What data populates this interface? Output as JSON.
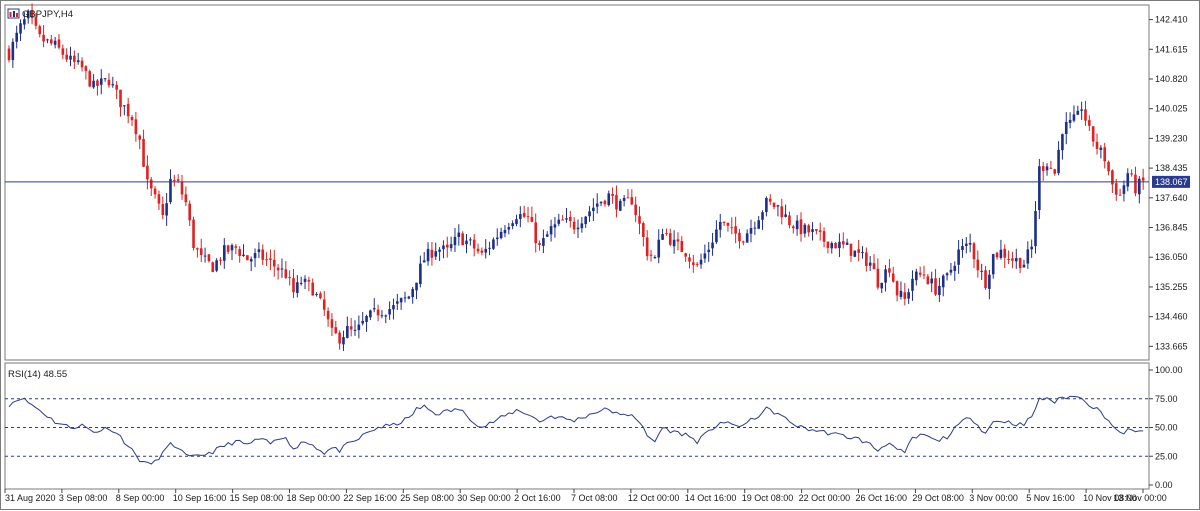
{
  "window": {
    "symbol_title": "GBPJPY,H4",
    "rsi_title": "RSI(14) 48.55",
    "current_price_label": "138.067"
  },
  "colors": {
    "bull": "#1c2f8a",
    "bear": "#e22020",
    "rsi_line": "#2a3a8c",
    "price_line": "#2a3a8c",
    "level_line": "#2a3a8c",
    "text": "#1a1a1a"
  },
  "chart_data": [
    {
      "type": "candlestick",
      "title": "GBPJPY,H4",
      "y_ticks": [
        "142.410",
        "141.615",
        "140.820",
        "140.025",
        "139.230",
        "138.435",
        "137.640",
        "136.845",
        "136.050",
        "135.255",
        "134.460",
        "133.665"
      ],
      "ylim": [
        133.3,
        142.8
      ],
      "current_price": 138.067,
      "x_ticks": [
        "31 Aug 2020",
        "3 Sep 08:00",
        "8 Sep 00:00",
        "10 Sep 16:00",
        "15 Sep 08:00",
        "18 Sep 00:00",
        "22 Sep 16:00",
        "25 Sep 08:00",
        "30 Sep 00:00",
        "2 Oct 16:00",
        "7 Oct 08:00",
        "12 Oct 00:00",
        "14 Oct 16:00",
        "19 Oct 08:00",
        "22 Oct 00:00",
        "26 Oct 16:00",
        "29 Oct 08:00",
        "3 Nov 00:00",
        "5 Nov 16:00",
        "10 Nov 08:00",
        "13 Nov 00:00"
      ],
      "close_path": [
        [
          0,
          141.5
        ],
        [
          3,
          142.2
        ],
        [
          5,
          142.5
        ],
        [
          8,
          141.9
        ],
        [
          12,
          141.7
        ],
        [
          16,
          141.3
        ],
        [
          19,
          141.1
        ],
        [
          22,
          140.6
        ],
        [
          26,
          140.8
        ],
        [
          29,
          140.2
        ],
        [
          32,
          139.8
        ],
        [
          34,
          139.2
        ],
        [
          36,
          138.0
        ],
        [
          38,
          137.6
        ],
        [
          40,
          137.1
        ],
        [
          42,
          138.1
        ],
        [
          44,
          138.0
        ],
        [
          46,
          137.5
        ],
        [
          48,
          136.4
        ],
        [
          50,
          136.0
        ],
        [
          53,
          135.8
        ],
        [
          56,
          136.2
        ],
        [
          59,
          136.3
        ],
        [
          62,
          136.0
        ],
        [
          65,
          136.1
        ],
        [
          68,
          135.9
        ],
        [
          72,
          135.6
        ],
        [
          74,
          135.1
        ],
        [
          76,
          135.4
        ],
        [
          79,
          135.2
        ],
        [
          82,
          134.6
        ],
        [
          84,
          134.0
        ],
        [
          86,
          133.9
        ],
        [
          88,
          134.1
        ],
        [
          90,
          134.0
        ],
        [
          93,
          134.4
        ],
        [
          96,
          134.6
        ],
        [
          100,
          134.7
        ],
        [
          104,
          135.0
        ],
        [
          106,
          135.5
        ],
        [
          108,
          136.0
        ],
        [
          111,
          136.3
        ],
        [
          114,
          136.2
        ],
        [
          117,
          136.6
        ],
        [
          120,
          136.4
        ],
        [
          123,
          136.1
        ],
        [
          126,
          136.5
        ],
        [
          129,
          136.9
        ],
        [
          132,
          137.2
        ],
        [
          135,
          137.1
        ],
        [
          138,
          136.3
        ],
        [
          141,
          136.8
        ],
        [
          144,
          137.0
        ],
        [
          147,
          136.9
        ],
        [
          150,
          137.2
        ],
        [
          153,
          137.5
        ],
        [
          156,
          137.7
        ],
        [
          159,
          137.4
        ],
        [
          162,
          137.6
        ],
        [
          164,
          136.9
        ],
        [
          166,
          136.2
        ],
        [
          168,
          136.0
        ],
        [
          170,
          136.8
        ],
        [
          173,
          136.4
        ],
        [
          176,
          136.2
        ],
        [
          179,
          135.8
        ],
        [
          182,
          136.3
        ],
        [
          185,
          137.0
        ],
        [
          188,
          136.7
        ],
        [
          191,
          136.6
        ],
        [
          194,
          137.0
        ],
        [
          197,
          137.5
        ],
        [
          200,
          137.4
        ],
        [
          203,
          137.0
        ],
        [
          206,
          136.8
        ],
        [
          209,
          136.7
        ],
        [
          212,
          136.5
        ],
        [
          215,
          136.4
        ],
        [
          218,
          136.3
        ],
        [
          221,
          136.1
        ],
        [
          224,
          135.9
        ],
        [
          226,
          135.4
        ],
        [
          229,
          135.8
        ],
        [
          231,
          135.1
        ],
        [
          233,
          134.9
        ],
        [
          235,
          135.5
        ],
        [
          238,
          135.6
        ],
        [
          241,
          135.2
        ],
        [
          244,
          135.5
        ],
        [
          247,
          136.2
        ],
        [
          250,
          136.4
        ],
        [
          252,
          135.8
        ],
        [
          254,
          135.4
        ],
        [
          256,
          136.1
        ],
        [
          258,
          136.2
        ],
        [
          261,
          136.0
        ],
        [
          264,
          135.9
        ],
        [
          266,
          136.3
        ],
        [
          268,
          138.4
        ],
        [
          270,
          138.6
        ],
        [
          272,
          138.3
        ],
        [
          274,
          139.5
        ],
        [
          276,
          139.6
        ],
        [
          278,
          139.8
        ],
        [
          279,
          140.1
        ],
        [
          281,
          139.4
        ],
        [
          283,
          139.0
        ],
        [
          285,
          138.7
        ],
        [
          287,
          138.0
        ],
        [
          289,
          137.7
        ],
        [
          291,
          138.3
        ],
        [
          293,
          137.9
        ],
        [
          295,
          138.06
        ]
      ]
    },
    {
      "type": "line",
      "title": "RSI(14) 48.55",
      "value": 48.55,
      "y_ticks": [
        "100.00",
        "75.00",
        "50.00",
        "25.00",
        "0.00"
      ],
      "ylim": [
        0,
        100
      ],
      "levels": [
        75,
        50,
        25
      ],
      "rsi_path": [
        [
          0,
          70
        ],
        [
          3,
          76
        ],
        [
          5,
          72
        ],
        [
          8,
          65
        ],
        [
          12,
          55
        ],
        [
          16,
          50
        ],
        [
          19,
          52
        ],
        [
          22,
          46
        ],
        [
          26,
          50
        ],
        [
          29,
          42
        ],
        [
          32,
          30
        ],
        [
          34,
          22
        ],
        [
          36,
          18
        ],
        [
          38,
          20
        ],
        [
          40,
          28
        ],
        [
          42,
          35
        ],
        [
          44,
          33
        ],
        [
          46,
          25
        ],
        [
          48,
          24
        ],
        [
          50,
          26
        ],
        [
          53,
          29
        ],
        [
          56,
          34
        ],
        [
          59,
          38
        ],
        [
          62,
          35
        ],
        [
          65,
          40
        ],
        [
          68,
          36
        ],
        [
          72,
          43
        ],
        [
          74,
          30
        ],
        [
          76,
          38
        ],
        [
          79,
          35
        ],
        [
          82,
          28
        ],
        [
          84,
          32
        ],
        [
          86,
          30
        ],
        [
          88,
          35
        ],
        [
          90,
          38
        ],
        [
          93,
          45
        ],
        [
          96,
          50
        ],
        [
          100,
          52
        ],
        [
          104,
          58
        ],
        [
          106,
          66
        ],
        [
          108,
          68
        ],
        [
          111,
          62
        ],
        [
          114,
          64
        ],
        [
          117,
          66
        ],
        [
          120,
          58
        ],
        [
          123,
          50
        ],
        [
          126,
          55
        ],
        [
          129,
          60
        ],
        [
          132,
          65
        ],
        [
          135,
          62
        ],
        [
          138,
          55
        ],
        [
          141,
          60
        ],
        [
          144,
          58
        ],
        [
          147,
          56
        ],
        [
          150,
          60
        ],
        [
          153,
          64
        ],
        [
          156,
          66
        ],
        [
          159,
          60
        ],
        [
          162,
          62
        ],
        [
          164,
          55
        ],
        [
          166,
          42
        ],
        [
          168,
          38
        ],
        [
          170,
          50
        ],
        [
          173,
          46
        ],
        [
          176,
          44
        ],
        [
          179,
          38
        ],
        [
          182,
          46
        ],
        [
          185,
          55
        ],
        [
          188,
          52
        ],
        [
          191,
          52
        ],
        [
          194,
          58
        ],
        [
          197,
          66
        ],
        [
          200,
          62
        ],
        [
          203,
          55
        ],
        [
          206,
          50
        ],
        [
          209,
          48
        ],
        [
          212,
          46
        ],
        [
          215,
          44
        ],
        [
          218,
          42
        ],
        [
          221,
          40
        ],
        [
          224,
          35
        ],
        [
          226,
          30
        ],
        [
          229,
          38
        ],
        [
          231,
          30
        ],
        [
          233,
          28
        ],
        [
          235,
          40
        ],
        [
          238,
          44
        ],
        [
          241,
          38
        ],
        [
          244,
          42
        ],
        [
          247,
          52
        ],
        [
          250,
          60
        ],
        [
          252,
          52
        ],
        [
          254,
          45
        ],
        [
          256,
          55
        ],
        [
          258,
          56
        ],
        [
          261,
          54
        ],
        [
          264,
          52
        ],
        [
          266,
          60
        ],
        [
          268,
          74
        ],
        [
          270,
          76
        ],
        [
          272,
          72
        ],
        [
          274,
          76
        ],
        [
          276,
          77
        ],
        [
          278,
          76
        ],
        [
          279,
          77
        ],
        [
          281,
          70
        ],
        [
          283,
          66
        ],
        [
          285,
          60
        ],
        [
          287,
          52
        ],
        [
          289,
          44
        ],
        [
          291,
          48
        ],
        [
          293,
          45
        ],
        [
          295,
          48.55
        ]
      ]
    }
  ]
}
